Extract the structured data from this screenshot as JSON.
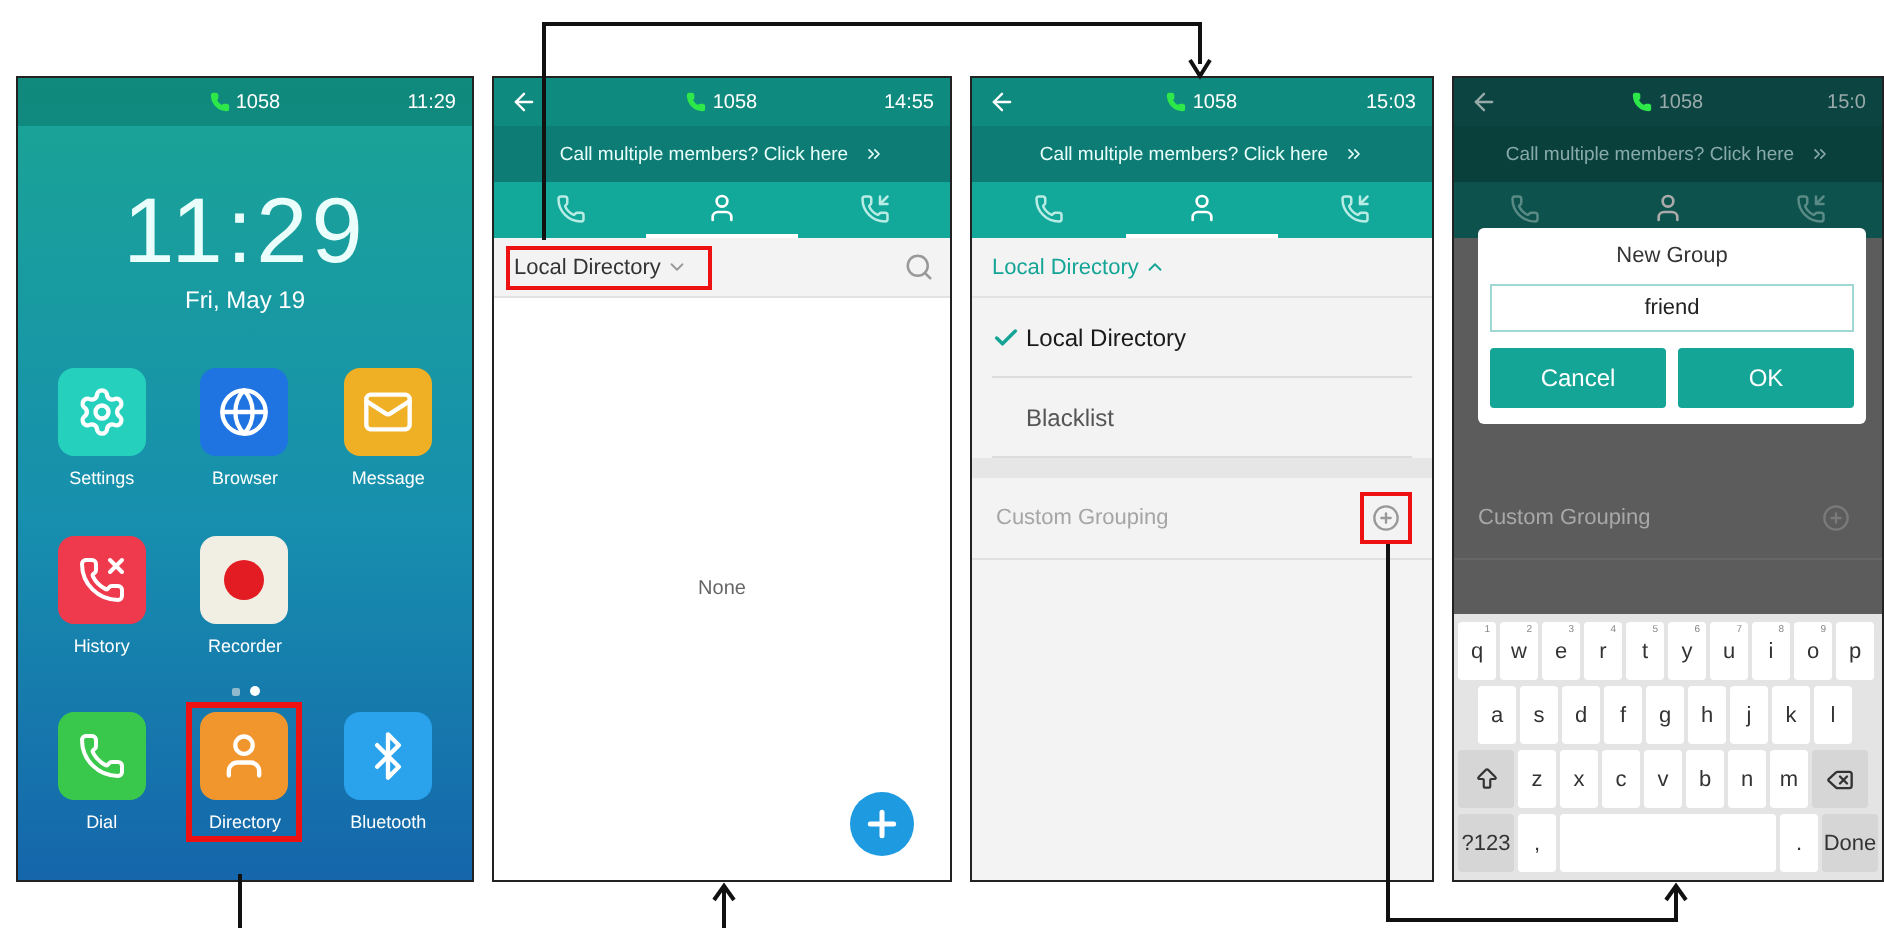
{
  "screens": [
    {
      "kind": "home",
      "status": {
        "line": "1058",
        "time": "11:29"
      },
      "clock": "11:29",
      "date": "Fri, May 19",
      "apps": [
        {
          "kind": "settings",
          "label": "Settings",
          "color": "#25d0bd",
          "highlighted": false
        },
        {
          "kind": "browser",
          "label": "Browser",
          "color": "#1f74e2",
          "highlighted": false
        },
        {
          "kind": "message",
          "label": "Message",
          "color": "#efb026",
          "highlighted": false
        },
        {
          "kind": "history",
          "label": "History",
          "color": "#ee3a4c",
          "highlighted": false
        },
        {
          "kind": "recorder",
          "label": "Recorder",
          "color": "#f1eee4",
          "highlighted": false
        }
      ],
      "page_dots": [
        {
          "selected": false
        },
        {
          "selected": true
        }
      ],
      "dock": [
        {
          "kind": "dial",
          "label": "Dial",
          "color": "#39c84b",
          "highlighted": false
        },
        {
          "kind": "directory",
          "label": "Directory",
          "color": "#f0962c",
          "highlighted": true
        },
        {
          "kind": "bluetooth",
          "label": "Bluetooth",
          "color": "#2aa3ec",
          "highlighted": false
        }
      ]
    },
    {
      "kind": "directory",
      "status": {
        "back": true,
        "line": "1058",
        "time": "14:55"
      },
      "banner": "Call multiple members? Click here",
      "tabs": [
        {
          "kind": "calls",
          "selected": false
        },
        {
          "kind": "contacts",
          "selected": true
        },
        {
          "kind": "history",
          "selected": false
        }
      ],
      "dropdown": {
        "label": "Local Directory",
        "expanded": false,
        "highlighted": true
      },
      "empty_text": "None"
    },
    {
      "kind": "groups",
      "status": {
        "back": true,
        "line": "1058",
        "time": "15:03"
      },
      "banner": "Call multiple members? Click here",
      "tabs": [
        {
          "kind": "calls",
          "selected": false
        },
        {
          "kind": "contacts",
          "selected": true
        },
        {
          "kind": "history",
          "selected": false
        }
      ],
      "dropdown": {
        "label": "Local Directory",
        "expanded": true,
        "highlighted": false
      },
      "menu": [
        {
          "label": "Local Directory",
          "selected": true
        },
        {
          "label": "Blacklist",
          "selected": false
        }
      ],
      "section": {
        "label": "Custom Grouping",
        "highlighted": true
      }
    },
    {
      "kind": "dialog",
      "status": {
        "back": true,
        "line": "1058",
        "time": "15:0"
      },
      "banner": "Call multiple members? Click here",
      "tabs": [
        {
          "kind": "calls",
          "selected": false
        },
        {
          "kind": "contacts",
          "selected": true
        },
        {
          "kind": "history",
          "selected": false
        }
      ],
      "section": {
        "label": "Custom Grouping",
        "highlighted": false
      },
      "dialog": {
        "title": "New Group",
        "value": "friend",
        "buttons": [
          "Cancel",
          "OK"
        ]
      },
      "keyboard": [
        [
          {
            "kind": "char",
            "label": "q",
            "hint": "1"
          },
          {
            "kind": "char",
            "label": "w",
            "hint": "2"
          },
          {
            "kind": "char",
            "label": "e",
            "hint": "3"
          },
          {
            "kind": "char",
            "label": "r",
            "hint": "4"
          },
          {
            "kind": "char",
            "label": "t",
            "hint": "5"
          },
          {
            "kind": "char",
            "label": "y",
            "hint": "6"
          },
          {
            "kind": "char",
            "label": "u",
            "hint": "7"
          },
          {
            "kind": "char",
            "label": "i",
            "hint": "8"
          },
          {
            "kind": "char",
            "label": "o",
            "hint": "9"
          },
          {
            "kind": "char",
            "label": "p"
          }
        ],
        [
          {
            "kind": "char",
            "label": "a"
          },
          {
            "kind": "char",
            "label": "s"
          },
          {
            "kind": "char",
            "label": "d"
          },
          {
            "kind": "char",
            "label": "f"
          },
          {
            "kind": "char",
            "label": "g"
          },
          {
            "kind": "char",
            "label": "h"
          },
          {
            "kind": "char",
            "label": "j"
          },
          {
            "kind": "char",
            "label": "k"
          },
          {
            "kind": "char",
            "label": "l"
          }
        ],
        [
          {
            "kind": "shift"
          },
          {
            "kind": "char",
            "label": "z"
          },
          {
            "kind": "char",
            "label": "x"
          },
          {
            "kind": "char",
            "label": "c"
          },
          {
            "kind": "char",
            "label": "v"
          },
          {
            "kind": "char",
            "label": "b"
          },
          {
            "kind": "char",
            "label": "n"
          },
          {
            "kind": "char",
            "label": "m"
          },
          {
            "kind": "backspace"
          }
        ],
        [
          {
            "kind": "action",
            "label": "?123"
          },
          {
            "kind": "char",
            "label": ","
          },
          {
            "kind": "space"
          },
          {
            "kind": "char",
            "label": "."
          },
          {
            "kind": "action",
            "label": "Done"
          }
        ]
      ]
    }
  ]
}
